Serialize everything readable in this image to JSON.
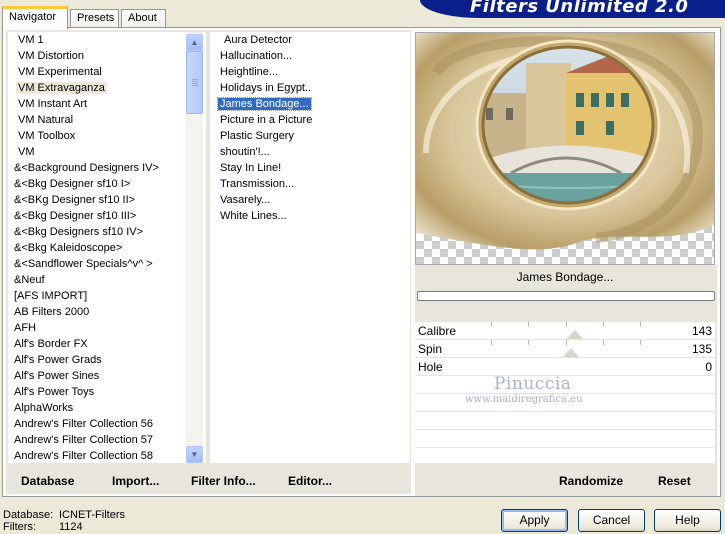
{
  "banner": {
    "title": "Filters Unlimited 2.0"
  },
  "tabs": [
    {
      "label": "Navigator",
      "active": true
    },
    {
      "label": "Presets",
      "active": false
    },
    {
      "label": "About",
      "active": false
    }
  ],
  "categories": [
    "VM 1",
    "VM Distortion",
    "VM Experimental",
    "VM Extravaganza",
    "VM Instant Art",
    "VM Natural",
    "VM Toolbox",
    "VM",
    "&<Background Designers IV>",
    "&<Bkg Designer sf10 I>",
    "&<BKg Designer sf10 II>",
    "&<Bkg Designer sf10 III>",
    "&<Bkg Designers sf10 IV>",
    "&<Bkg Kaleidoscope>",
    "&<Sandflower Specials^v^ >",
    "&Neuf",
    "[AFS IMPORT]",
    "AB Filters 2000",
    "AFH",
    "Alf's Border FX",
    "Alf's Power Grads",
    "Alf's Power Sines",
    "Alf's Power Toys",
    "AlphaWorks",
    "Andrew's Filter Collection 56",
    "Andrew's Filter Collection 57",
    "Andrew's Filter Collection 58"
  ],
  "selected_category": "VM Extravaganza",
  "filters": [
    "Aura Detector",
    "Hallucination...",
    "Heightline...",
    "Holidays in Egypt..",
    "James Bondage...",
    "Picture in a Picture",
    "Plastic Surgery",
    "shoutin'!...",
    "Stay In Line!",
    "Transmission...",
    "Vasarely...",
    "White Lines..."
  ],
  "selected_filter": "James Bondage...",
  "left_buttons": {
    "database": "Database",
    "import": "Import...",
    "filter_info": "Filter Info...",
    "editor": "Editor..."
  },
  "preview": {
    "filter_name": "James Bondage..."
  },
  "progress": 0,
  "sliders": [
    {
      "label": "Calibre",
      "value": "143",
      "level": 0.56
    },
    {
      "label": "Spin",
      "value": "135",
      "level": 0.53
    },
    {
      "label": "Hole",
      "value": "0",
      "level": 0.0
    }
  ],
  "watermark": {
    "name": "Pinuccia",
    "url": "www.maidiregrafica.eu"
  },
  "right_buttons": {
    "randomize": "Randomize",
    "reset": "Reset"
  },
  "status": {
    "database_label": "Database:",
    "database_value": "ICNET-Filters",
    "filters_label": "Filters:",
    "filters_value": "1124"
  },
  "dialog_buttons": {
    "apply": "Apply",
    "cancel": "Cancel",
    "help": "Help"
  },
  "colors": {
    "banner": "#0b1f8a",
    "selection": "#316ac5",
    "tab_highlight": "#ffc83c"
  }
}
